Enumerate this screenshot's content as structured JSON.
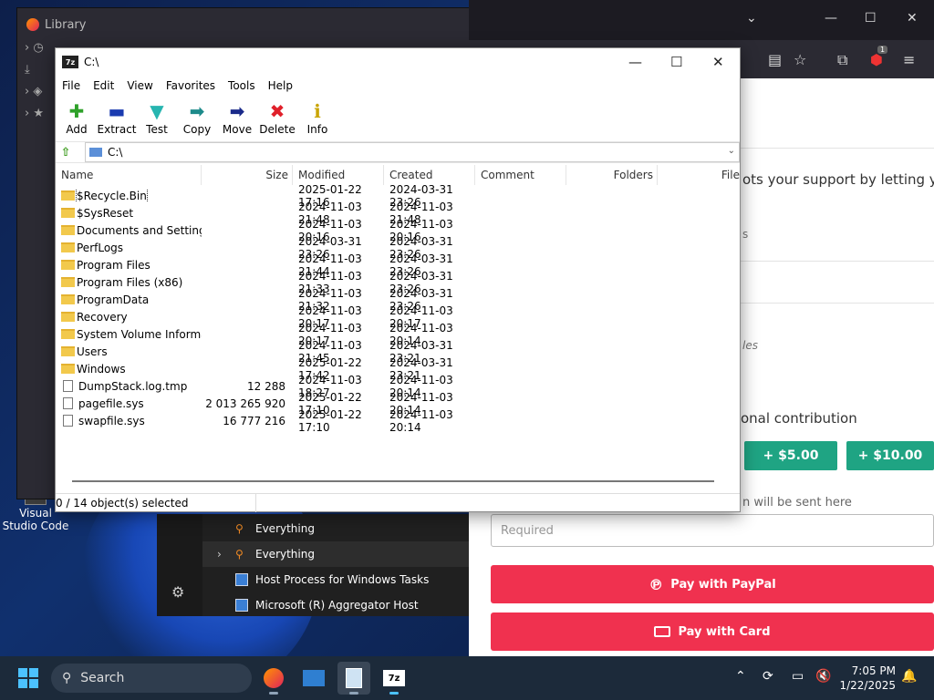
{
  "desktop": {
    "icons": [
      {
        "label": "Visual Studio Code"
      }
    ]
  },
  "library": {
    "title": "Library"
  },
  "firefox_page": {
    "support_text": "ots your support by letting you",
    "faded_s": "s",
    "faded_les": "les",
    "contribution_text": "onal contribution",
    "amounts": [
      "+ $5.00",
      "+ $10.00"
    ],
    "email_note": "n will be sent here",
    "required_placeholder": "Required",
    "pay_paypal": "Pay with PayPal",
    "pay_card": "Pay with Card",
    "badge": "1"
  },
  "task_panel": {
    "rows": [
      {
        "label": "Everything",
        "icon": "search-icon"
      },
      {
        "label": "Everything",
        "icon": "search-icon",
        "expander": "›"
      },
      {
        "label": "Host Process for Windows Tasks",
        "icon": "window-icon"
      },
      {
        "label": "Microsoft (R) Aggregator Host",
        "icon": "window-icon"
      }
    ]
  },
  "sevenzip": {
    "app_icon": "7z",
    "title": "C:\\",
    "menu": [
      "File",
      "Edit",
      "View",
      "Favorites",
      "Tools",
      "Help"
    ],
    "toolbar": [
      {
        "label": "Add",
        "glyph": "✚",
        "color": "#2fa12a",
        "icon": "add-icon"
      },
      {
        "label": "Extract",
        "glyph": "▬",
        "color": "#1a3bb0",
        "icon": "extract-icon"
      },
      {
        "label": "Test",
        "glyph": "▼",
        "color": "#27b5b0",
        "icon": "test-icon"
      },
      {
        "label": "Copy",
        "glyph": "➡",
        "color": "#1d8a8a",
        "icon": "copy-icon"
      },
      {
        "label": "Move",
        "glyph": "➡",
        "color": "#1a2a8a",
        "icon": "move-icon"
      },
      {
        "label": "Delete",
        "glyph": "✖",
        "color": "#e0202a",
        "icon": "delete-icon"
      },
      {
        "label": "Info",
        "glyph": "ℹ",
        "color": "#c9a400",
        "icon": "info-icon"
      }
    ],
    "address": "C:\\",
    "columns": [
      "Name",
      "Size",
      "Modified",
      "Created",
      "Comment",
      "Folders",
      "File"
    ],
    "rows": [
      {
        "name": "$Recycle.Bin",
        "size": "",
        "modified": "2025-01-22 17:16",
        "created": "2024-03-31 23:26",
        "type": "folder"
      },
      {
        "name": "$SysReset",
        "size": "",
        "modified": "2024-11-03 21:48",
        "created": "2024-11-03 21:48",
        "type": "folder"
      },
      {
        "name": "Documents and Settings",
        "size": "",
        "modified": "2024-11-03 20:16",
        "created": "2024-11-03 20:16",
        "type": "folder"
      },
      {
        "name": "PerfLogs",
        "size": "",
        "modified": "2024-03-31 23:26",
        "created": "2024-03-31 23:26",
        "type": "folder"
      },
      {
        "name": "Program Files",
        "size": "",
        "modified": "2024-11-03 21:44",
        "created": "2024-03-31 23:26",
        "type": "folder"
      },
      {
        "name": "Program Files (x86)",
        "size": "",
        "modified": "2024-11-03 21:33",
        "created": "2024-03-31 23:26",
        "type": "folder"
      },
      {
        "name": "ProgramData",
        "size": "",
        "modified": "2024-11-03 21:32",
        "created": "2024-03-31 23:26",
        "type": "folder"
      },
      {
        "name": "Recovery",
        "size": "",
        "modified": "2024-11-03 20:17",
        "created": "2024-11-03 20:17",
        "type": "folder"
      },
      {
        "name": "System Volume Informa...",
        "size": "",
        "modified": "2024-11-03 20:17",
        "created": "2024-11-03 20:14",
        "type": "folder"
      },
      {
        "name": "Users",
        "size": "",
        "modified": "2024-11-03 21:45",
        "created": "2024-03-31 23:21",
        "type": "folder"
      },
      {
        "name": "Windows",
        "size": "",
        "modified": "2025-01-22 17:42",
        "created": "2024-03-31 23:21",
        "type": "folder"
      },
      {
        "name": "DumpStack.log.tmp",
        "size": "12 288",
        "modified": "2024-11-03 18:27",
        "created": "2024-11-03 20:14",
        "type": "file"
      },
      {
        "name": "pagefile.sys",
        "size": "2 013 265 920",
        "modified": "2025-01-22 17:10",
        "created": "2024-11-03 20:14",
        "type": "file"
      },
      {
        "name": "swapfile.sys",
        "size": "16 777 216",
        "modified": "2025-01-22 17:10",
        "created": "2024-11-03 20:14",
        "type": "file"
      }
    ],
    "status": "0 / 14 object(s) selected"
  },
  "taskbar": {
    "search_label": "Search",
    "time": "7:05 PM",
    "date": "1/22/2025"
  }
}
